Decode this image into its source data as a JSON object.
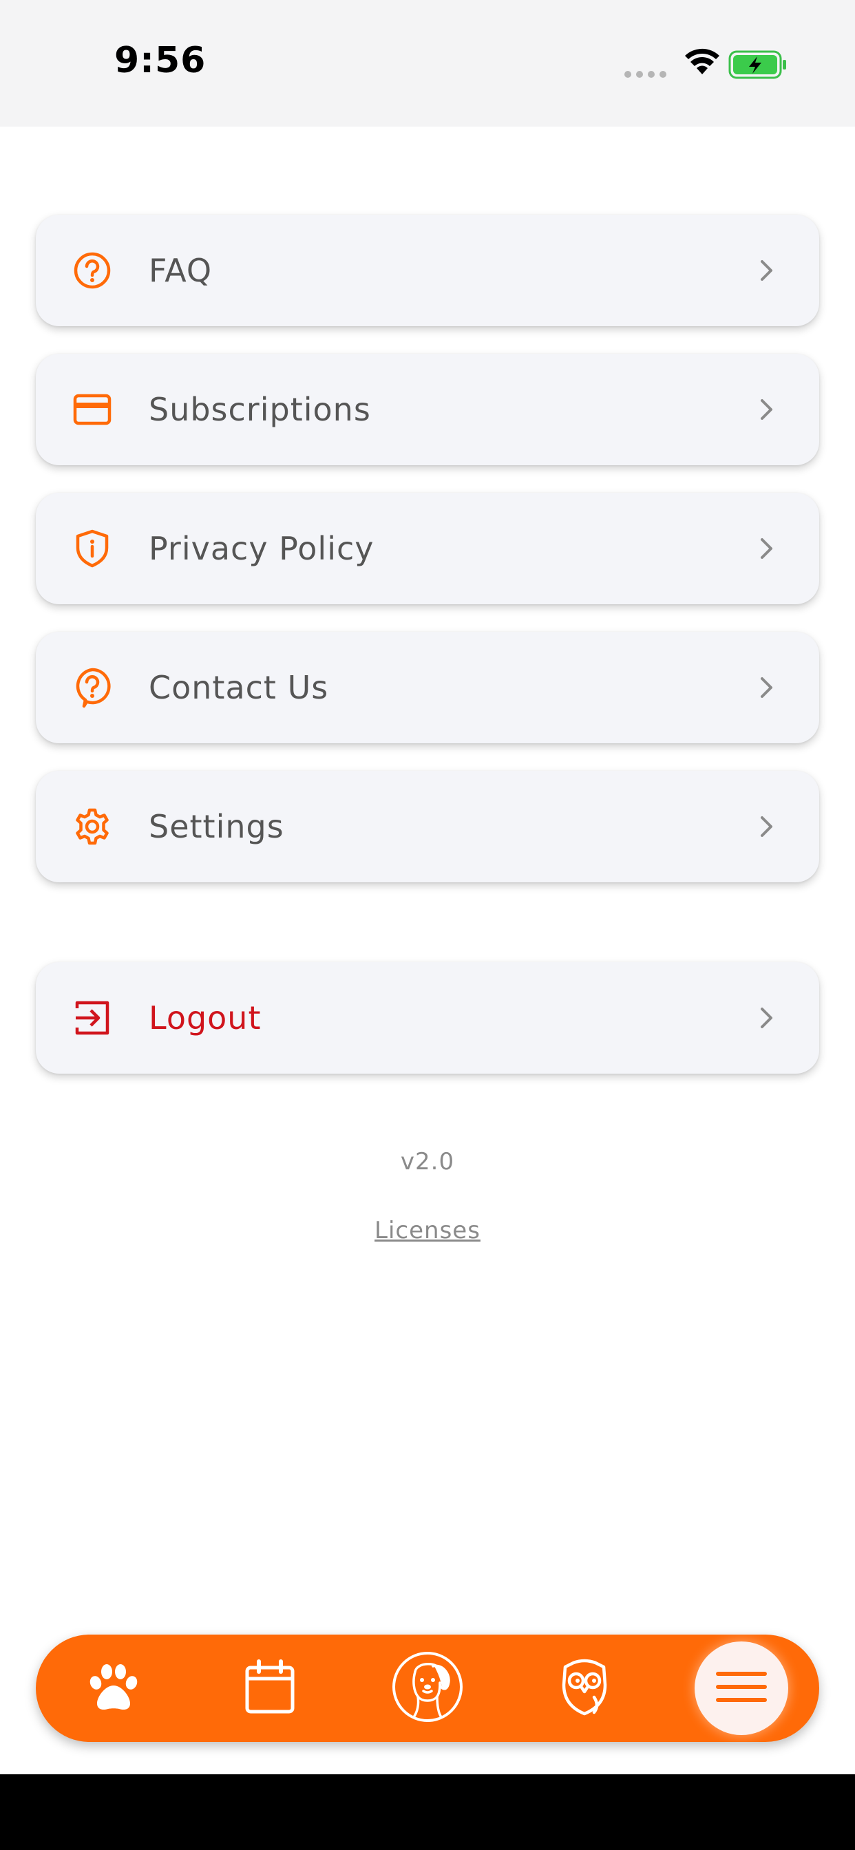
{
  "status_bar": {
    "time": "9:56"
  },
  "menu": {
    "items": [
      {
        "label": "FAQ",
        "icon": "question-circle-icon"
      },
      {
        "label": "Subscriptions",
        "icon": "credit-card-icon"
      },
      {
        "label": "Privacy Policy",
        "icon": "shield-info-icon"
      },
      {
        "label": "Contact Us",
        "icon": "question-bubble-icon"
      },
      {
        "label": "Settings",
        "icon": "gear-icon"
      }
    ],
    "logout": {
      "label": "Logout",
      "icon": "logout-icon"
    }
  },
  "footer": {
    "version": "v2.0",
    "licenses_link": "Licenses"
  },
  "tab_bar": {
    "tabs": [
      {
        "icon": "paw-icon"
      },
      {
        "icon": "calendar-icon"
      },
      {
        "icon": "dog-face-icon"
      },
      {
        "icon": "owl-icon"
      },
      {
        "icon": "menu-icon",
        "active": true
      }
    ]
  },
  "colors": {
    "accent": "#ff6a08",
    "danger": "#d0141c",
    "card_bg": "#f4f5f9",
    "text": "#555555",
    "muted_text": "#8a8a8a"
  }
}
